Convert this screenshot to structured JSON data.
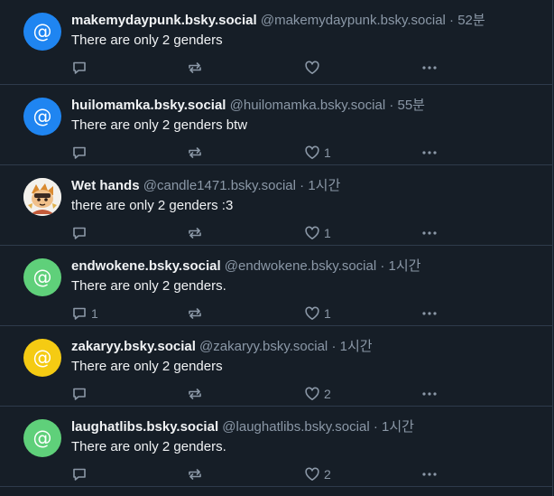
{
  "theme": {
    "background": "#161e27",
    "divider": "#2e3b4b",
    "text_primary": "#f1f3f5",
    "text_secondary": "#8b98a7"
  },
  "posts": [
    {
      "display_name": "makemydaypunk.bsky.social",
      "handle": "@makemydaypunk.bsky.social",
      "time": "52분",
      "text": "There are only 2 genders",
      "avatar_color": "#1f85f1",
      "avatar_type": "default-at-icon",
      "replies": "",
      "likes": ""
    },
    {
      "display_name": "huilomamka.bsky.social",
      "handle": "@huilomamka.bsky.social",
      "time": "55분",
      "text": "There are only 2 genders btw",
      "avatar_color": "#1f85f1",
      "avatar_type": "default-at-icon",
      "replies": "",
      "likes": "1"
    },
    {
      "display_name": "Wet hands",
      "handle": "@candle1471.bsky.social",
      "time": "1시간",
      "text": "there are only 2 genders :3",
      "avatar_color": "#ffffff",
      "avatar_type": "cartoon-character-picture",
      "replies": "",
      "likes": "1"
    },
    {
      "display_name": "endwokene.bsky.social",
      "handle": "@endwokene.bsky.social",
      "time": "1시간",
      "text": "There are only 2 genders.",
      "avatar_color": "#5fd07a",
      "avatar_type": "default-at-icon",
      "replies": "1",
      "likes": "1"
    },
    {
      "display_name": "zakaryy.bsky.social",
      "handle": "@zakaryy.bsky.social",
      "time": "1시간",
      "text": "There are only 2 genders",
      "avatar_color": "#f5cb13",
      "avatar_type": "default-at-icon",
      "replies": "",
      "likes": "2"
    },
    {
      "display_name": "laughatlibs.bsky.social",
      "handle": "@laughatlibs.bsky.social",
      "time": "1시간",
      "text": "There are only 2 genders.",
      "avatar_color": "#5fd07a",
      "avatar_type": "default-at-icon",
      "replies": "",
      "likes": "2"
    }
  ],
  "icons": {
    "reply": "speech-bubble-icon",
    "repost": "repost-arrows-icon",
    "like": "heart-icon",
    "more": "ellipsis-icon"
  }
}
